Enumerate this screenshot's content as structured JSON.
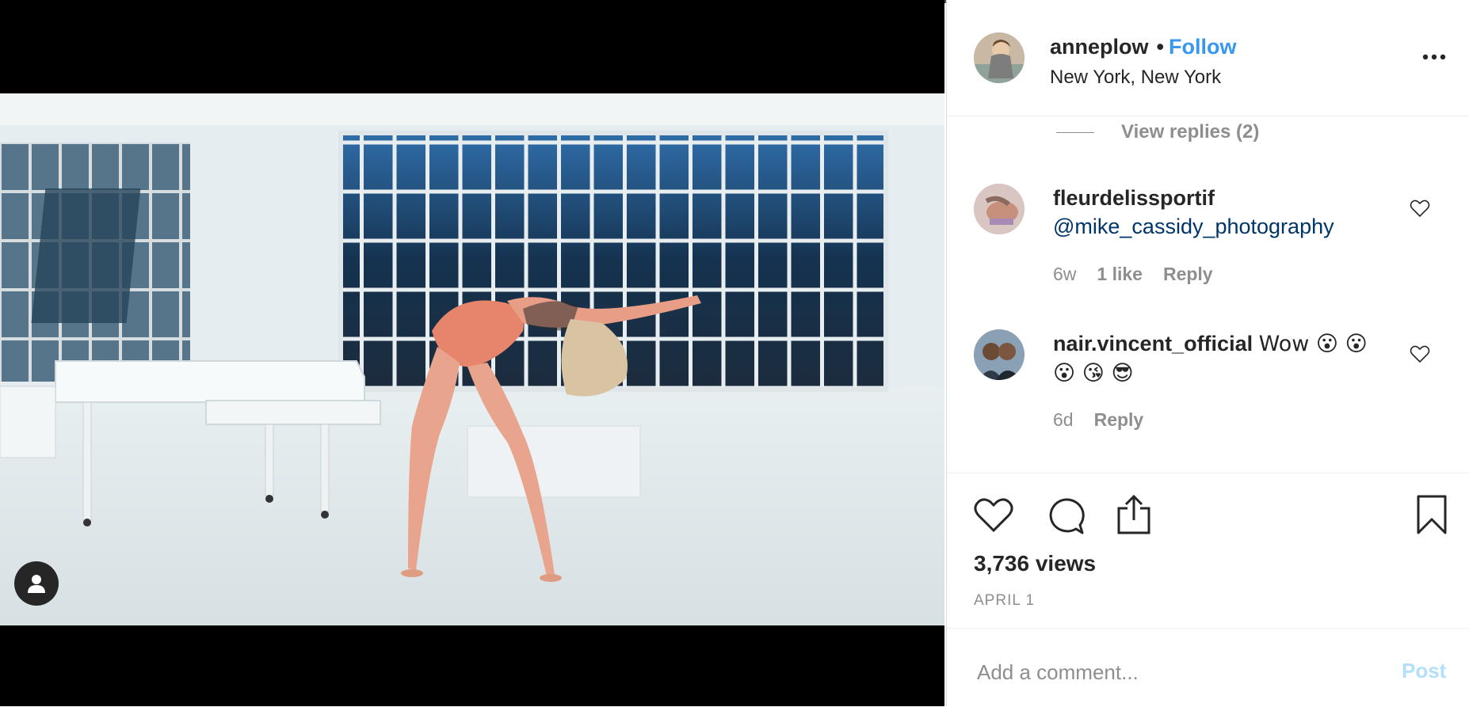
{
  "post": {
    "username": "anneplow",
    "separator": "•",
    "follow_label": "Follow",
    "location": "New York, New York",
    "more_label": "..."
  },
  "comments": {
    "view_replies": "View replies (2)",
    "items": [
      {
        "username": "fleurdelissportif",
        "mention": "@mike_cassidy_photography",
        "time": "6w",
        "likes": "1 like",
        "reply": "Reply"
      },
      {
        "username": "nair.vincent_official",
        "text": "Wow 😮 😮",
        "text_line2": "😮 😘 😎",
        "time": "6d",
        "reply": "Reply"
      }
    ]
  },
  "actions": {
    "icons": [
      "heart-icon",
      "comment-icon",
      "share-icon",
      "bookmark-icon"
    ],
    "views": "3,736 views",
    "date": "APRIL 1"
  },
  "add_comment": {
    "placeholder": "Add a comment...",
    "post_label": "Post"
  },
  "colors": {
    "link_blue": "#3897f0",
    "mention_blue": "#003569",
    "muted_gray": "#8e8e8e",
    "post_disabled": "#b2dffc"
  }
}
